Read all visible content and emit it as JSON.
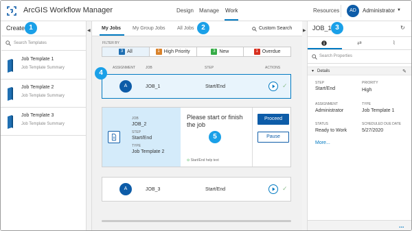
{
  "header": {
    "app_title": "ArcGIS Workflow Manager",
    "nav": [
      "Design",
      "Manage",
      "Work"
    ],
    "active_nav": "Work",
    "resources": "Resources",
    "user_initials": "AD",
    "user_name": "Administrator"
  },
  "create_panel": {
    "title": "Create",
    "search_placeholder": "Search Templates",
    "templates": [
      {
        "name": "Job Template 1",
        "summary": "Job Template Summary"
      },
      {
        "name": "Job Template 2",
        "summary": "Job Template Summary"
      },
      {
        "name": "Job Template 3",
        "summary": "Job Template Summary"
      }
    ]
  },
  "jobs_panel": {
    "tabs": [
      "My Jobs",
      "My Group Jobs",
      "All Jobs"
    ],
    "active_tab": "My Jobs",
    "custom_search": "Custom Search",
    "filter_label": "FILTER BY",
    "filters": [
      {
        "count": "3",
        "label": "All",
        "color": "#1f6fb2"
      },
      {
        "count": "1",
        "label": "High Priority",
        "color": "#d9822b"
      },
      {
        "count": "3",
        "label": "New",
        "color": "#35ac46"
      },
      {
        "count": "1",
        "label": "Overdue",
        "color": "#d83020"
      }
    ],
    "columns": [
      "ASSIGNMENT",
      "JOB",
      "STEP",
      "ACTIONS"
    ],
    "jobs": [
      {
        "initial": "A",
        "name": "JOB_1",
        "step": "Start/End"
      },
      {
        "initial": "A",
        "name": "JOB_3",
        "step": "Start/End"
      }
    ],
    "expanded_job": {
      "job_label": "JOB",
      "job_value": "JOB_2",
      "step_label": "STEP",
      "step_value": "Start/End",
      "type_label": "TYPE",
      "type_value": "Job Template 2",
      "prompt": "Please start or finish the job",
      "help_text": "Start/End help text",
      "proceed": "Proceed",
      "pause": "Pause"
    }
  },
  "details_panel": {
    "title": "JOB_1",
    "search_placeholder": "Search Properties",
    "section": "Details",
    "fields": [
      {
        "label": "STEP",
        "value": "Start/End"
      },
      {
        "label": "PRIORITY",
        "value": "High"
      },
      {
        "label": "ASSIGNMENT",
        "value": "Administrator"
      },
      {
        "label": "TYPE",
        "value": "Job Template 1"
      },
      {
        "label": "STATUS",
        "value": "Ready to Work"
      },
      {
        "label": "SCHEDULED DUE DATE",
        "value": "5/27/2020"
      }
    ],
    "more": "More...",
    "dots": "..."
  },
  "callouts": [
    "1",
    "2",
    "3",
    "4",
    "5"
  ]
}
